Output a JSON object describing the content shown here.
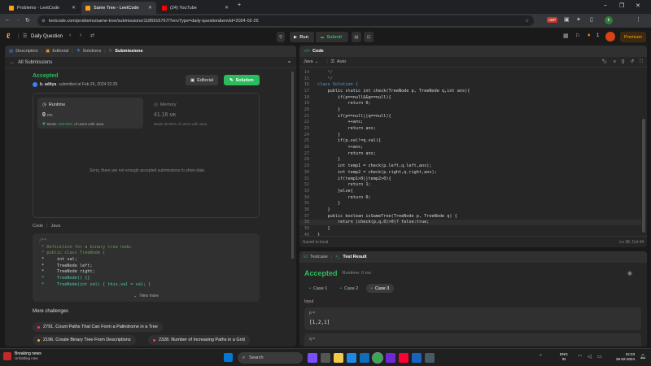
{
  "browser": {
    "tabs": [
      {
        "label": "Problems - LeetCode"
      },
      {
        "label": "Same Tree - LeetCode"
      },
      {
        "label": "(24) YouTube"
      }
    ],
    "new_tab": "+",
    "url": "leetcode.com/problems/same-tree/submissions/1186916767/?envType=daily-question&envId=2024-02-26",
    "ext_badge": "ABP"
  },
  "lcnav": {
    "daily_question": "Daily Question",
    "run": "Run",
    "submit": "Submit",
    "streak": "1",
    "premium": "Premium"
  },
  "left": {
    "tabs": [
      "Description",
      "Editorial",
      "Solutions",
      "Submissions"
    ],
    "all_submissions": "All Submissions",
    "status": "Accepted",
    "author": "b. aditya",
    "submitted_at": "submitted at Feb 26, 2024 22:20",
    "editorial_btn": "Editorial",
    "solution_btn": "Solution",
    "runtime_label": "Runtime",
    "runtime_value": "0",
    "runtime_unit": "ms",
    "runtime_beats_label": "Beats",
    "runtime_beats_value": "100.00%",
    "runtime_beats_suffix": "of users with Java",
    "memory_label": "Memory",
    "memory_value": "41.16",
    "memory_unit": "MB",
    "memory_beats": "Beats 30.80% of users with Java",
    "not_enough": "Sorry, there are not enough accepted submissions to show data",
    "code_label": "Code",
    "code_lang": "Java",
    "snippet": [
      "/**",
      " * Definition for a binary tree node.",
      " * public class TreeNode {",
      " *     int val;",
      " *     TreeNode left;",
      " *     TreeNode right;",
      " *     TreeNode() {}",
      " *     TreeNode(int val) { this.val = val; }"
    ],
    "view_more": "View more",
    "more_challenges": "More challenges",
    "challenges": [
      "2791. Count Paths That Can Form a Palindrome in a Tree",
      "2196. Create Binary Tree From Descriptions",
      "2328. Number of Increasing Paths in a Grid"
    ]
  },
  "editor": {
    "title": "Code",
    "lang": "Java",
    "auto": "Auto",
    "saved": "Saved to local",
    "cursor": "Ln 38, Col 44"
  },
  "code_lines": [
    {
      "n": "14",
      "t": "    */",
      "c": "cm"
    },
    {
      "n": "15",
      "t": "    */",
      "c": "cm"
    },
    {
      "n": "16",
      "t": "class Solution {",
      "c": "kw"
    },
    {
      "n": "17",
      "t": "    public static int check(TreeNode p, TreeNode q,int ans){",
      "c": "txt"
    },
    {
      "n": "18",
      "t": "        if(p==null&&q==null){",
      "c": "txt"
    },
    {
      "n": "19",
      "t": "            return 0;",
      "c": "txt"
    },
    {
      "n": "20",
      "t": "        }",
      "c": "txt"
    },
    {
      "n": "21",
      "t": "        if(p==null||q==null){",
      "c": "txt"
    },
    {
      "n": "22",
      "t": "            ++ans;",
      "c": "txt"
    },
    {
      "n": "23",
      "t": "            return ans;",
      "c": "txt"
    },
    {
      "n": "24",
      "t": "        }",
      "c": "txt"
    },
    {
      "n": "25",
      "t": "        if(p.val!=q.val){",
      "c": "txt"
    },
    {
      "n": "26",
      "t": "            ++ans;",
      "c": "txt"
    },
    {
      "n": "27",
      "t": "            return ans;",
      "c": "txt"
    },
    {
      "n": "28",
      "t": "        }",
      "c": "txt"
    },
    {
      "n": "29",
      "t": "        int temp1 = check(p.left,q.left,ans);",
      "c": "txt"
    },
    {
      "n": "30",
      "t": "        int temp2 = check(p.right,q.right,ans);",
      "c": "txt"
    },
    {
      "n": "31",
      "t": "        if(temp1>0||temp2>0){",
      "c": "txt"
    },
    {
      "n": "32",
      "t": "            return 1;",
      "c": "txt"
    },
    {
      "n": "33",
      "t": "        }else{",
      "c": "txt"
    },
    {
      "n": "34",
      "t": "            return 0;",
      "c": "txt"
    },
    {
      "n": "35",
      "t": "        }",
      "c": "txt"
    },
    {
      "n": "36",
      "t": "    }",
      "c": "txt"
    },
    {
      "n": "37",
      "t": "    public boolean isSameTree(TreeNode p, TreeNode q) {",
      "c": "txt"
    },
    {
      "n": "38",
      "t": "        return (check(p,q,0)>0)? false:true;",
      "c": "txt"
    },
    {
      "n": "39",
      "t": "    }",
      "c": "txt"
    },
    {
      "n": "40",
      "t": "}",
      "c": "txt"
    }
  ],
  "result": {
    "testcase_tab": "Testcase",
    "testresult_tab": "Test Result",
    "status": "Accepted",
    "runtime": "Runtime: 0 ms",
    "cases": [
      "Case 1",
      "Case 2",
      "Case 3"
    ],
    "input_label": "Input",
    "p_label": "p =",
    "p_value": "[1,2,1]",
    "q_label": "q ="
  },
  "taskbar": {
    "news_title": "Breaking news",
    "news_sub": "Unfolding now",
    "search": "Search",
    "lang1": "ENG",
    "lang2": "IN",
    "time": "22:23",
    "date": "26-02-2024"
  }
}
